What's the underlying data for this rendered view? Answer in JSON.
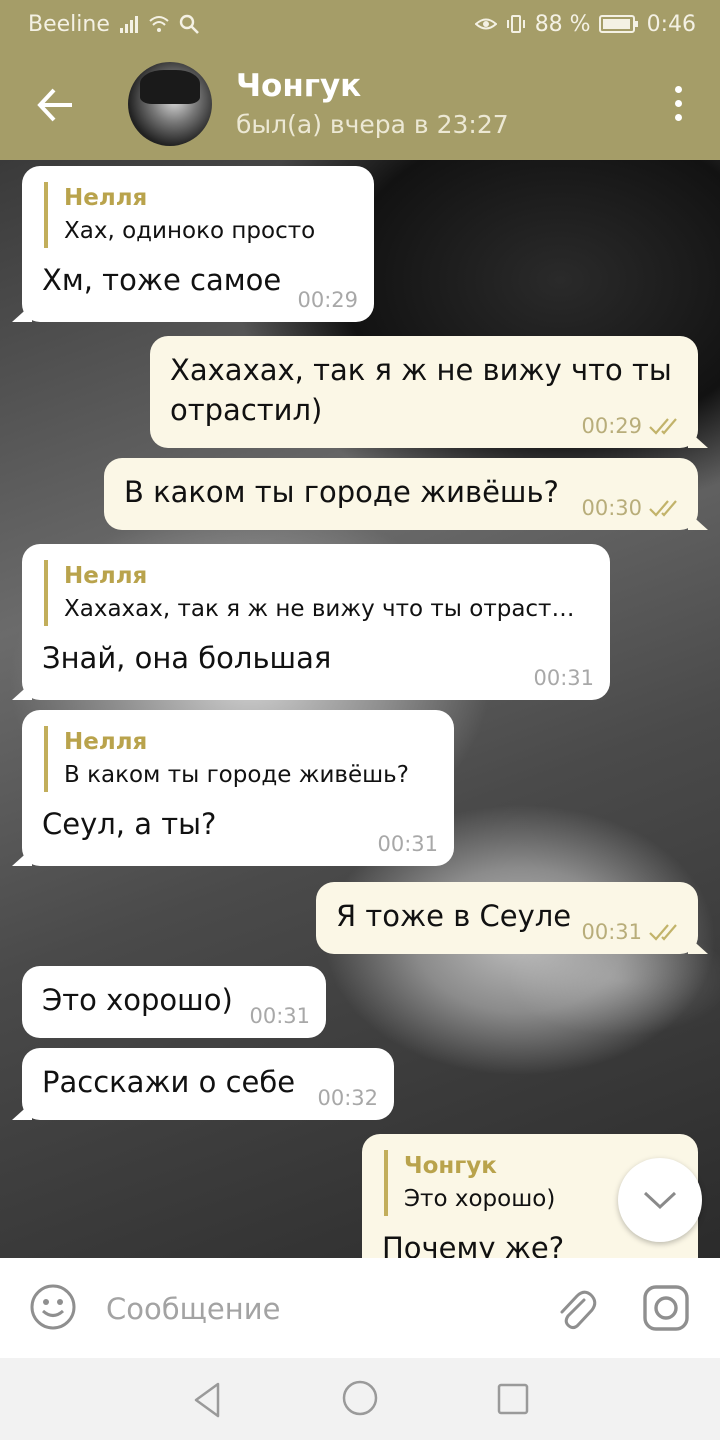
{
  "status_bar": {
    "carrier": "Beeline",
    "battery": "88 %",
    "time": "0:46"
  },
  "header": {
    "contact_name": "Чонгук",
    "last_seen": "был(а) вчера в 23:27"
  },
  "messages": [
    {
      "dir": "in",
      "reply_name": "Нелля",
      "reply_text": "Хах, одиноко просто",
      "text": "Хм, тоже самое",
      "time": "00:29"
    },
    {
      "dir": "out",
      "text": "Хахахах, так я ж не вижу что ты отрастил)",
      "time": "00:29"
    },
    {
      "dir": "out",
      "text": "В каком ты городе живёшь?",
      "time": "00:30"
    },
    {
      "dir": "in",
      "reply_name": "Нелля",
      "reply_text": "Хахахах, так я ж не вижу что ты отраст…",
      "text": "Знай, она большая",
      "time": "00:31"
    },
    {
      "dir": "in",
      "reply_name": "Нелля",
      "reply_text": "В каком ты городе живёшь?",
      "text": "Сеул, а ты?",
      "time": "00:31"
    },
    {
      "dir": "out",
      "text": "Я тоже в Сеуле",
      "time": "00:31"
    },
    {
      "dir": "in",
      "text": "Это хорошо)",
      "time": "00:31"
    },
    {
      "dir": "in",
      "text": "Расскажи о себе",
      "time": "00:32"
    },
    {
      "dir": "out",
      "reply_name": "Чонгук",
      "reply_text": "Это хорошо)",
      "text": "Почему же?"
    }
  ],
  "input": {
    "placeholder": "Сообщение"
  },
  "colors": {
    "header": "#a59d68",
    "accent": "#b9a34c",
    "outgoing_bubble": "#fbf7e6",
    "incoming_bubble": "#ffffff"
  }
}
